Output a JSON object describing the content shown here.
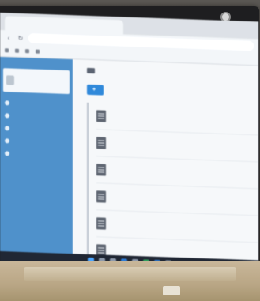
{
  "browser": {
    "tab_title": "",
    "url": "",
    "bookmarks": []
  },
  "sidebar": {
    "brand": "",
    "items": [
      {
        "label": "",
        "icon": "circle-icon"
      },
      {
        "label": "",
        "icon": "circle-icon"
      },
      {
        "label": "",
        "icon": "circle-icon"
      },
      {
        "label": "",
        "icon": "circle-icon"
      },
      {
        "label": "",
        "icon": "circle-icon"
      }
    ]
  },
  "content": {
    "title": "",
    "new_button_label": "",
    "documents": [
      {
        "name": ""
      },
      {
        "name": ""
      },
      {
        "name": ""
      },
      {
        "name": ""
      },
      {
        "name": ""
      },
      {
        "name": ""
      }
    ]
  },
  "colors": {
    "sidebar": "#4d8ec7",
    "accent": "#2f86d6",
    "link": "#4a7fc0"
  }
}
